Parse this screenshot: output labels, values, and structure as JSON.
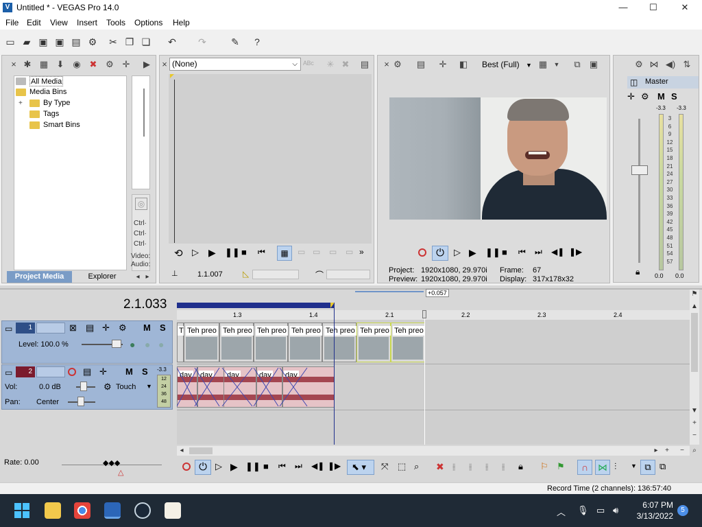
{
  "window": {
    "title": "Untitled * - VEGAS Pro 14.0",
    "logo": "V"
  },
  "window_controls": {
    "minimize": "—",
    "maximize": "☐",
    "close": "✕"
  },
  "menu": [
    "File",
    "Edit",
    "View",
    "Insert",
    "Tools",
    "Options",
    "Help"
  ],
  "project_media": {
    "tree": [
      "All Media",
      "Media Bins",
      "By Type",
      "Tags",
      "Smart Bins"
    ],
    "expand_symbol": "+",
    "tabs": [
      "Project Media",
      "Explorer"
    ],
    "side_labels": [
      "Ctrl·",
      "Ctrl·",
      "Ctrl·",
      "Video:",
      "Audio:"
    ]
  },
  "trimmer": {
    "select_value": "(None)",
    "time": "1.1.007"
  },
  "preview": {
    "quality": "Best (Full)",
    "project_label": "Project:",
    "project_value": "1920x1080, 29.970i",
    "preview_label": "Preview:",
    "preview_value": "1920x1080, 29.970i",
    "frame_label": "Frame:",
    "frame_value": "67",
    "display_label": "Display:",
    "display_value": "317x178x32"
  },
  "master": {
    "label": "Master",
    "m": "M",
    "s": "S",
    "peak_left": "-3.3",
    "peak_right": "-3.3",
    "scale": [
      "3",
      "6",
      "9",
      "12",
      "15",
      "18",
      "21",
      "24",
      "27",
      "30",
      "33",
      "36",
      "39",
      "42",
      "45",
      "48",
      "51",
      "54",
      "57"
    ],
    "bottom_left": "0.0",
    "bottom_right": "0.0"
  },
  "timeline": {
    "cursor_time": "2.1.033",
    "offset_badge": "+0.057",
    "ruler": [
      "1.3",
      "1.4",
      "2.1",
      "2.2",
      "2.3",
      "2.4"
    ],
    "video_track": {
      "number": "1",
      "m": "M",
      "s": "S",
      "level_label": "Level: 100.0 %"
    },
    "audio_track": {
      "number": "2",
      "m": "M",
      "s": "S",
      "vol_label": "Vol:",
      "vol_value": "0.0 dB",
      "pan_label": "Pan:",
      "pan_value": "Center",
      "automation": "Touch",
      "peak": "-3.3",
      "mini_scale": [
        "12",
        "24",
        "36",
        "48"
      ]
    },
    "video_clips": [
      "T",
      "Teh preo",
      "Teh preo",
      "Teh preo",
      "Teh preo",
      "Teh preo",
      "Teh preo",
      "Teh preo"
    ],
    "audio_clips": [
      "day",
      "day",
      "day",
      "day",
      "day"
    ],
    "rate": "Rate: 0.00"
  },
  "status": {
    "record_time": "Record Time (2 channels): 136:57:40"
  },
  "taskbar": {
    "time": "6:07 PM",
    "date": "3/13/2022",
    "notification_count": "5"
  }
}
